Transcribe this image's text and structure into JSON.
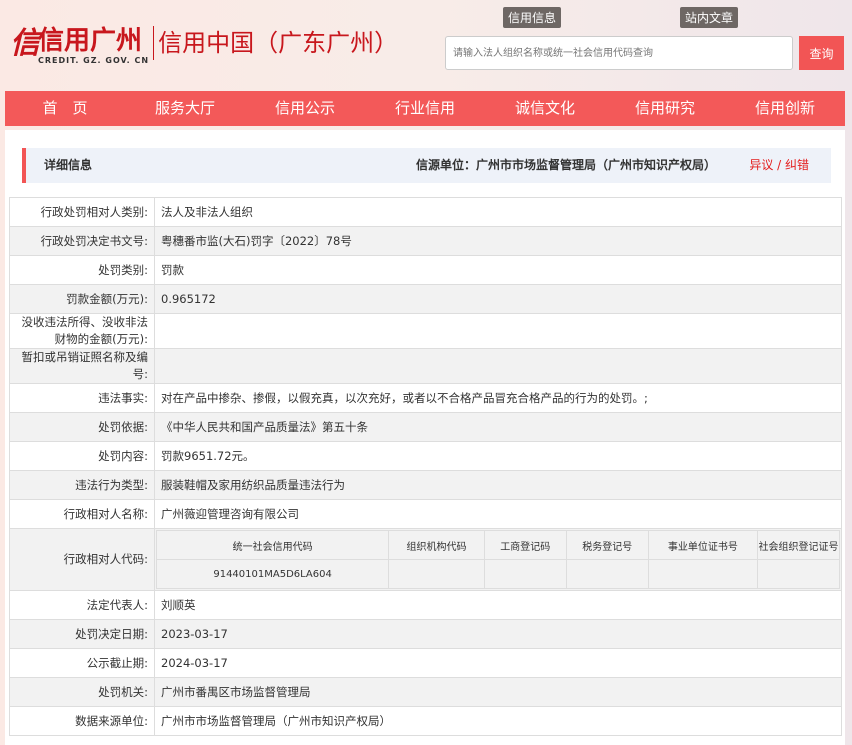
{
  "header": {
    "logo_main": "信用广州",
    "logo_sub": "CREDIT. GZ. GOV. CN",
    "logo_cn": "信用中国（广东广州）",
    "tabs": [
      "信用信息",
      "站内文章"
    ],
    "search_placeholder": "请输入法人组织名称或统一社会信用代码查询",
    "search_button": "查询"
  },
  "nav": [
    "首　页",
    "服务大厅",
    "信用公示",
    "行业信用",
    "诚信文化",
    "信用研究",
    "信用创新"
  ],
  "detail": {
    "title": "详细信息",
    "source": "信源单位：广州市市场监督管理局（广州市知识产权局）",
    "objection": "异议 / 纠错"
  },
  "rows": [
    {
      "label": "行政处罚相对人类别:",
      "value": "法人及非法人组织"
    },
    {
      "label": "行政处罚决定书文号:",
      "value": "粤穗番市监(大石)罚字〔2022〕78号"
    },
    {
      "label": "处罚类别:",
      "value": "罚款"
    },
    {
      "label": "罚款金额(万元):",
      "value": "0.965172"
    },
    {
      "label": "没收违法所得、没收非法财物的金额(万元):",
      "value": ""
    },
    {
      "label": "暂扣或吊销证照名称及编号:",
      "value": ""
    },
    {
      "label": "违法事实:",
      "value": "对在产品中掺杂、掺假，以假充真，以次充好，或者以不合格产品冒充合格产品的行为的处罚。;"
    },
    {
      "label": "处罚依据:",
      "value": "《中华人民共和国产品质量法》第五十条"
    },
    {
      "label": "处罚内容:",
      "value": "罚款9651.72元。"
    },
    {
      "label": "违法行为类型:",
      "value": "服装鞋帽及家用纺织品质量违法行为"
    },
    {
      "label": "行政相对人名称:",
      "value": "广州薇迎管理咨询有限公司"
    }
  ],
  "codes": {
    "label": "行政相对人代码:",
    "headers": [
      "统一社会信用代码",
      "组织机构代码",
      "工商登记码",
      "税务登记号",
      "事业单位证书号",
      "社会组织登记证号"
    ],
    "values": [
      "91440101MA5D6LA604",
      "",
      "",
      "",
      "",
      ""
    ]
  },
  "rows2": [
    {
      "label": "法定代表人:",
      "value": "刘顺英"
    },
    {
      "label": "处罚决定日期:",
      "value": "2023-03-17"
    },
    {
      "label": "公示截止期:",
      "value": "2024-03-17"
    },
    {
      "label": "处罚机关:",
      "value": "广州市番禺区市场监督管理局"
    },
    {
      "label": "数据来源单位:",
      "value": "广州市市场监督管理局（广州市知识产权局）"
    }
  ]
}
